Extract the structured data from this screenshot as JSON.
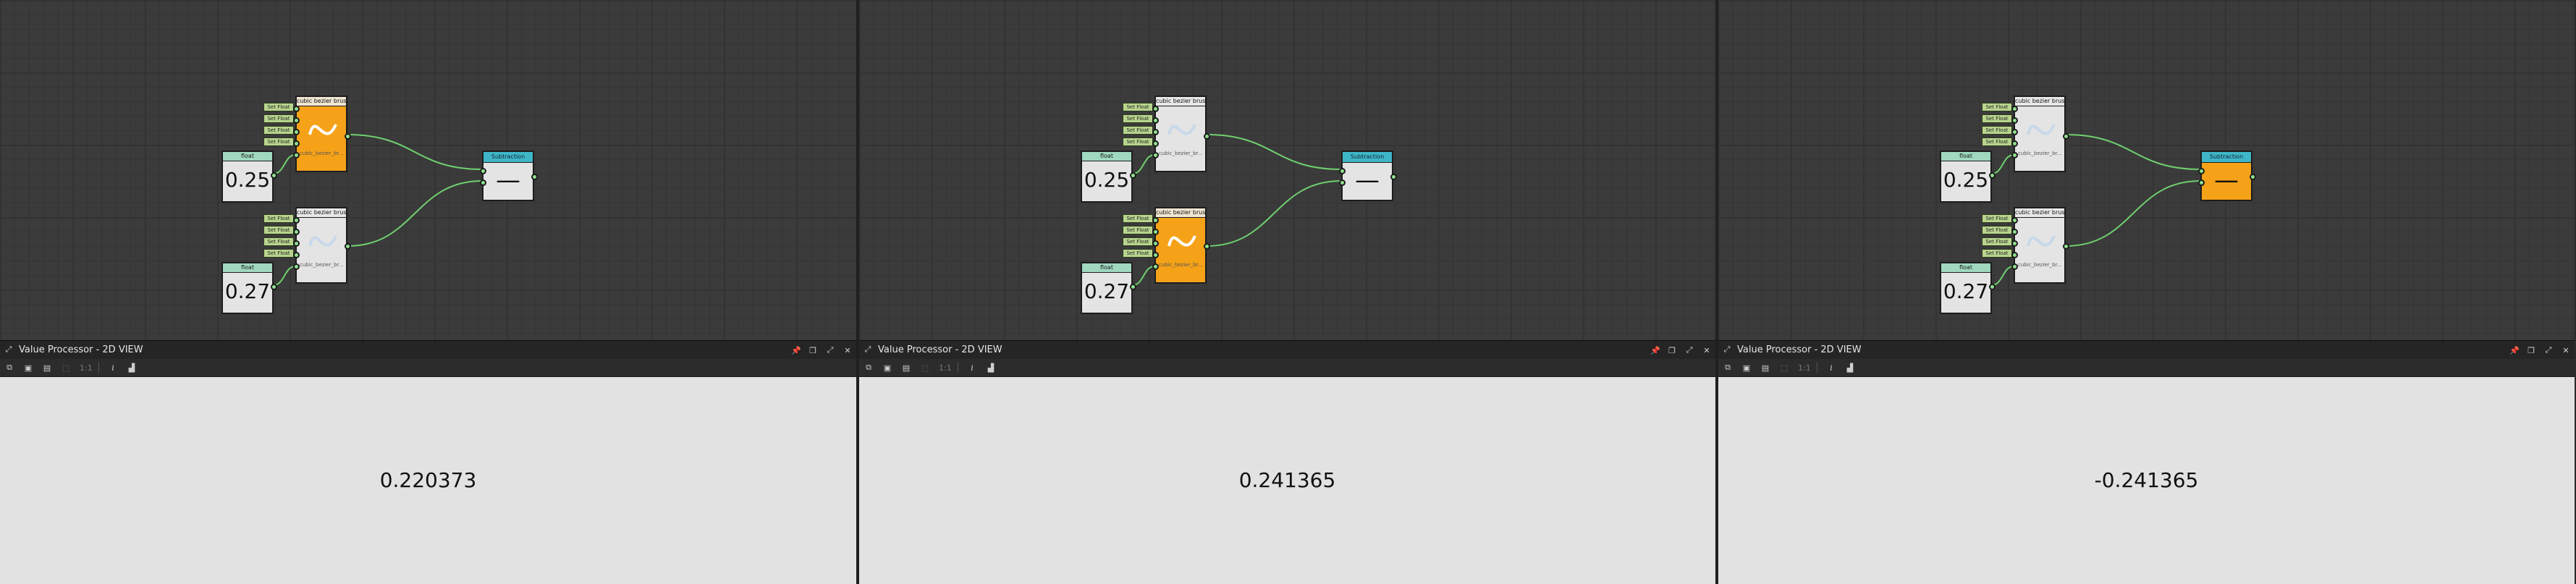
{
  "window": {
    "view_title": "Value Processor - 2D VIEW"
  },
  "icons": {
    "header_left": "maximize-icon",
    "header_right": [
      "pin-icon",
      "restore-icon",
      "maximize-icon",
      "close-icon"
    ],
    "toolbar": [
      "copy-icon",
      "save-icon",
      "save-as-icon",
      "export-icon",
      "zoom-icon",
      "info-icon",
      "histogram-icon"
    ]
  },
  "toolbar": {
    "zoom_label": "1:1",
    "info_label": "i"
  },
  "node_labels": {
    "float": "float",
    "set_float": "Set Float",
    "bezier_title": "cubic bezier brush",
    "bezier_sub": "cubic_bezier_br...",
    "subtraction": "Subtraction",
    "operator": "—"
  },
  "panels": [
    {
      "float_a": "0.25",
      "float_b": "0.27",
      "active": "bezier_a",
      "result": "0.220373"
    },
    {
      "float_a": "0.25",
      "float_b": "0.27",
      "active": "bezier_b",
      "result": "0.241365"
    },
    {
      "float_a": "0.25",
      "float_b": "0.27",
      "active": "subtraction",
      "result": "-0.241365"
    }
  ],
  "colors": {
    "active_node": "#f5a219",
    "float_header": "#9fd7bf",
    "subtraction_header": "#3fb6c8",
    "set_float": "#b8d48e",
    "wire": "#6fd06f"
  }
}
